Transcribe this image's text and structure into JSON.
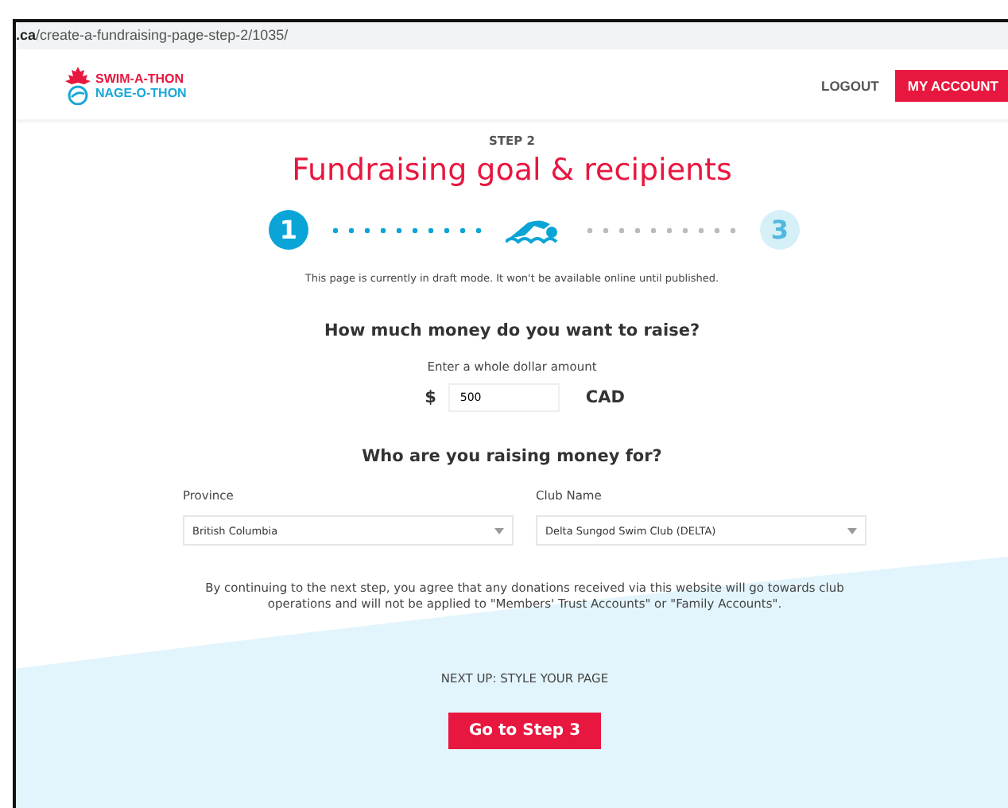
{
  "address_bar": {
    "host": ".ca",
    "path": "/create-a-fundraising-page-step-2/1035/"
  },
  "header": {
    "logo_line_1": "SWIM-A-THON",
    "logo_line_2": "NAGE-O-THON",
    "logout": "LOGOUT",
    "account_button": "MY ACCOUNT"
  },
  "step_label": "STEP 2",
  "title": "Fundraising goal & recipients",
  "steps": [
    {
      "label": "1",
      "done": true,
      "current": false
    },
    {
      "done": false,
      "current": true
    },
    {
      "label": "3",
      "done": false,
      "current": false
    }
  ],
  "draft_notice": "This page is currently in draft mode. It won't be available online until published.",
  "goal": {
    "heading": "How much money do you want to raise?",
    "hint": "Enter a whole dollar amount",
    "currency_symbol": "$",
    "value": "500",
    "currency": "CAD"
  },
  "recipients": {
    "heading": "Who are you raising money for?",
    "fields": [
      {
        "label": "Province",
        "value": "British Columbia"
      },
      {
        "label": "Club Name",
        "value": "Delta Sungod Swim Club (DELTA)"
      }
    ]
  },
  "agreement": "By continuing to the next step, you agree that any donations received via this website will go towards club operations and will not be applied to \"Members' Trust Accounts\" or \"Family Accounts\".",
  "next_up": "NEXT UP: STYLE YOUR PAGE",
  "next_button": "Go to Step 3"
}
